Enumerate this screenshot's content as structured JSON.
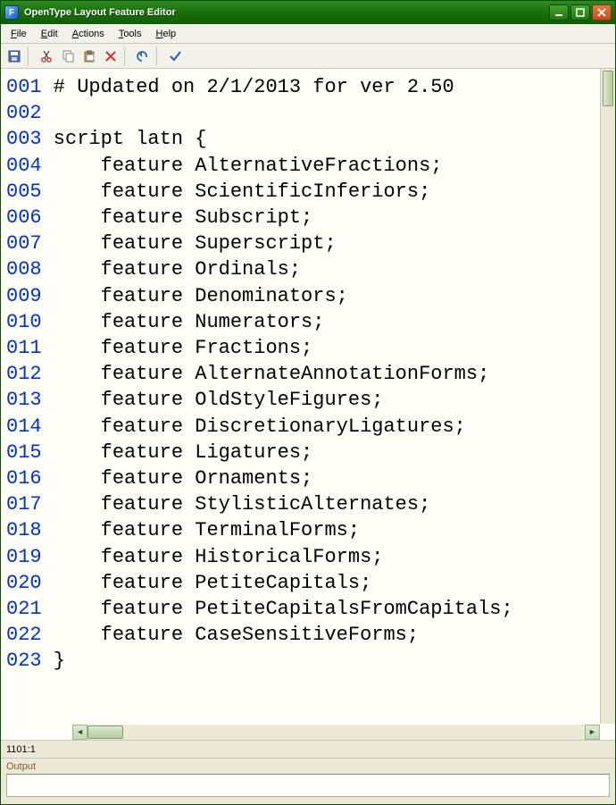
{
  "window": {
    "title": "OpenType Layout Feature Editor"
  },
  "menus": {
    "file": "File",
    "edit": "Edit",
    "actions": "Actions",
    "tools": "Tools",
    "help": "Help"
  },
  "toolbar_icons": {
    "save": "save-icon",
    "cut": "cut-icon",
    "copy": "copy-icon",
    "paste": "paste-icon",
    "delete": "delete-icon",
    "undo": "undo-icon",
    "check": "check-icon"
  },
  "code_lines": [
    {
      "num": "001",
      "text": "# Updated on 2/1/2013 for ver 2.50"
    },
    {
      "num": "002",
      "text": ""
    },
    {
      "num": "003",
      "text": "script latn {"
    },
    {
      "num": "004",
      "text": "    feature AlternativeFractions;"
    },
    {
      "num": "005",
      "text": "    feature ScientificInferiors;"
    },
    {
      "num": "006",
      "text": "    feature Subscript;"
    },
    {
      "num": "007",
      "text": "    feature Superscript;"
    },
    {
      "num": "008",
      "text": "    feature Ordinals;"
    },
    {
      "num": "009",
      "text": "    feature Denominators;"
    },
    {
      "num": "010",
      "text": "    feature Numerators;"
    },
    {
      "num": "011",
      "text": "    feature Fractions;"
    },
    {
      "num": "012",
      "text": "    feature AlternateAnnotationForms;"
    },
    {
      "num": "013",
      "text": "    feature OldStyleFigures;"
    },
    {
      "num": "014",
      "text": "    feature DiscretionaryLigatures;"
    },
    {
      "num": "015",
      "text": "    feature Ligatures;"
    },
    {
      "num": "016",
      "text": "    feature Ornaments;"
    },
    {
      "num": "017",
      "text": "    feature StylisticAlternates;"
    },
    {
      "num": "018",
      "text": "    feature TerminalForms;"
    },
    {
      "num": "019",
      "text": "    feature HistoricalForms;"
    },
    {
      "num": "020",
      "text": "    feature PetiteCapitals;"
    },
    {
      "num": "021",
      "text": "    feature PetiteCapitalsFromCapitals;"
    },
    {
      "num": "022",
      "text": "    feature CaseSensitiveForms;"
    },
    {
      "num": "023",
      "text": "}"
    }
  ],
  "status": {
    "position": "1101:1"
  },
  "output": {
    "label": "Output",
    "value": ""
  }
}
